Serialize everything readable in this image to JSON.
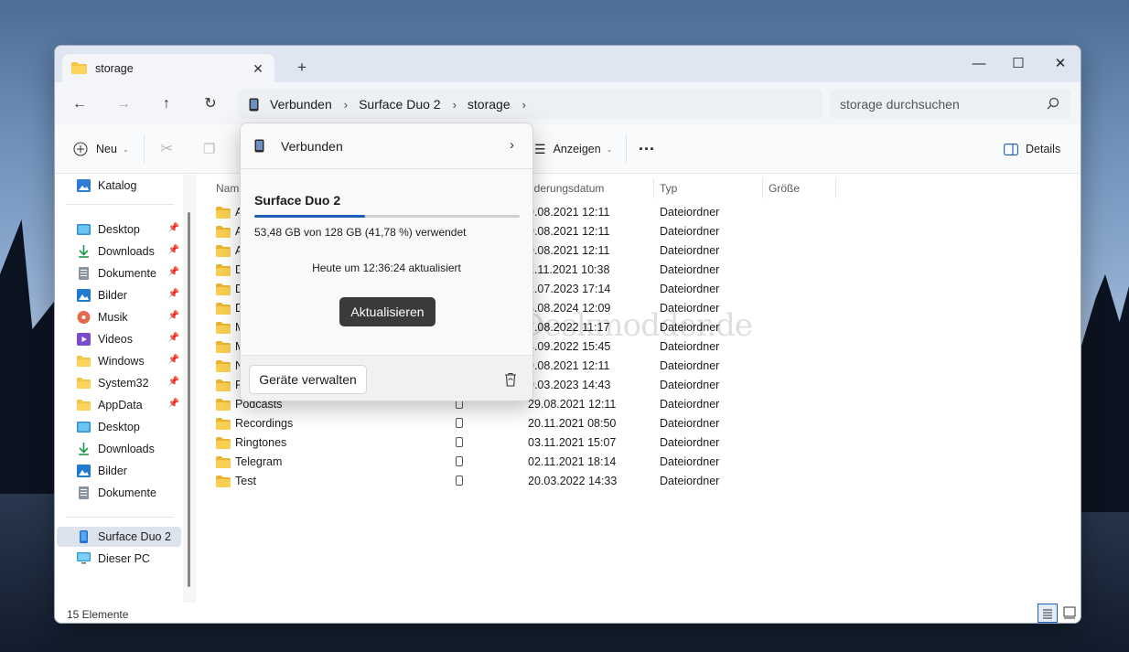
{
  "tab": {
    "title": "storage",
    "close": "✕",
    "new": "+"
  },
  "window_controls": {
    "minimize": "—",
    "maximize": "☐",
    "close": "✕"
  },
  "address": {
    "crumbs": [
      "Verbunden",
      "Surface Duo 2",
      "storage"
    ],
    "sep": "›"
  },
  "search": {
    "placeholder": "storage durchsuchen"
  },
  "toolbar": {
    "new_label": "Neu",
    "view_label": "Anzeigen",
    "more": "···",
    "details_label": "Details"
  },
  "sidebar": {
    "items": [
      {
        "label": "Katalog",
        "icon": "catalog-icon",
        "pinned": false
      },
      {
        "label": "Desktop",
        "icon": "desktop-icon",
        "pinned": true
      },
      {
        "label": "Downloads",
        "icon": "download-icon",
        "pinned": true
      },
      {
        "label": "Dokumente",
        "icon": "document-icon",
        "pinned": true
      },
      {
        "label": "Bilder",
        "icon": "pictures-icon",
        "pinned": true
      },
      {
        "label": "Musik",
        "icon": "music-icon",
        "pinned": true
      },
      {
        "label": "Videos",
        "icon": "video-icon",
        "pinned": true
      },
      {
        "label": "Windows",
        "icon": "folder-icon",
        "pinned": true
      },
      {
        "label": "System32",
        "icon": "folder-icon",
        "pinned": true
      },
      {
        "label": "AppData",
        "icon": "folder-icon",
        "pinned": true
      },
      {
        "label": "Desktop",
        "icon": "desktop-icon",
        "pinned": false
      },
      {
        "label": "Downloads",
        "icon": "download-icon",
        "pinned": false
      },
      {
        "label": "Bilder",
        "icon": "pictures-icon",
        "pinned": false
      },
      {
        "label": "Dokumente",
        "icon": "document-icon",
        "pinned": false
      },
      {
        "label": "Surface Duo 2",
        "icon": "phone-icon",
        "pinned": false,
        "selected": true
      },
      {
        "label": "Dieser PC",
        "icon": "pc-icon",
        "pinned": false
      }
    ],
    "pin_glyph": "📌"
  },
  "columns": {
    "name": "Nam",
    "date": "nderungsdatum",
    "type": "Typ",
    "size": "Größe"
  },
  "files": [
    {
      "name": "A",
      "date": "9.08.2021 12:11",
      "type": "Dateiordner"
    },
    {
      "name": "A",
      "date": "9.08.2021 12:11",
      "type": "Dateiordner"
    },
    {
      "name": "A",
      "date": "9.08.2021 12:11",
      "type": "Dateiordner"
    },
    {
      "name": "D",
      "date": "2.11.2021 10:38",
      "type": "Dateiordner"
    },
    {
      "name": "D",
      "date": "2.07.2023 17:14",
      "type": "Dateiordner"
    },
    {
      "name": "D",
      "date": "3.08.2024 12:09",
      "type": "Dateiordner"
    },
    {
      "name": "M",
      "date": "7.08.2022 11:17",
      "type": "Dateiordner"
    },
    {
      "name": "M",
      "date": "4.09.2022 15:45",
      "type": "Dateiordner"
    },
    {
      "name": "N",
      "date": "9.08.2021 12:11",
      "type": "Dateiordner"
    },
    {
      "name": "P",
      "date": "9.03.2023 14:43",
      "type": "Dateiordner"
    },
    {
      "name": "Podcasts",
      "date": "29.08.2021 12:11",
      "type": "Dateiordner"
    },
    {
      "name": "Recordings",
      "date": "20.11.2021 08:50",
      "type": "Dateiordner"
    },
    {
      "name": "Ringtones",
      "date": "03.11.2021 15:07",
      "type": "Dateiordner"
    },
    {
      "name": "Telegram",
      "date": "02.11.2021 18:14",
      "type": "Dateiordner"
    },
    {
      "name": "Test",
      "date": "20.03.2022 14:33",
      "type": "Dateiordner"
    }
  ],
  "status": {
    "count": "15 Elemente"
  },
  "popup": {
    "header": "Verbunden",
    "device": "Surface Duo 2",
    "usage": "53,48 GB von 128 GB (41,78 %) verwendet",
    "usage_fraction": 0.4178,
    "updated": "Heute um 12:36:24 aktualisiert",
    "refresh": "Aktualisieren",
    "manage": "Geräte verwalten"
  },
  "watermark": "Deskmodder.de",
  "colors": {
    "accent": "#1a5fb4",
    "folder": "#f4c542",
    "selected": "#dde3ec"
  }
}
